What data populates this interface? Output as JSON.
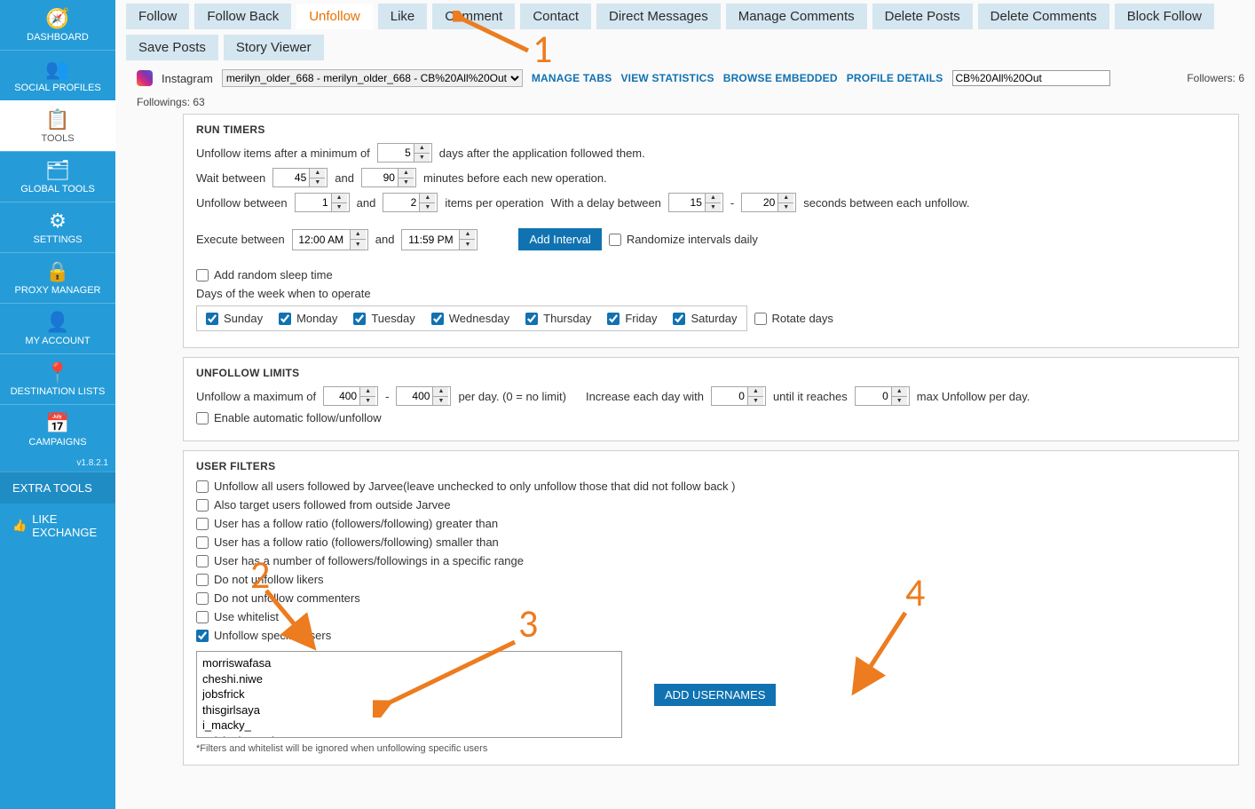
{
  "sidebar": {
    "items": [
      {
        "label": "DASHBOARD",
        "icon": "🧭"
      },
      {
        "label": "SOCIAL PROFILES",
        "icon": "👥"
      },
      {
        "label": "TOOLS",
        "icon": "📋",
        "active": true
      },
      {
        "label": "GLOBAL TOOLS",
        "icon": "🗂"
      },
      {
        "label": "SETTINGS",
        "icon": "⚙"
      },
      {
        "label": "PROXY MANAGER",
        "icon": "🔒"
      },
      {
        "label": "MY ACCOUNT",
        "icon": "👤"
      },
      {
        "label": "DESTINATION LISTS",
        "icon": "📍"
      },
      {
        "label": "CAMPAIGNS",
        "icon": "📅"
      }
    ],
    "version": "v1.8.2.1",
    "extra": "EXTRA TOOLS",
    "like": "LIKE EXCHANGE"
  },
  "tabs": [
    "Follow",
    "Follow Back",
    "Unfollow",
    "Like",
    "Comment",
    "Contact",
    "Direct Messages",
    "Manage Comments",
    "Delete Posts",
    "Delete Comments",
    "Block Follow",
    "Save Posts",
    "Story Viewer"
  ],
  "activeTab": "Unfollow",
  "accountbar": {
    "platform": "Instagram",
    "profileSelect": "merilyn_older_668 - merilyn_older_668 - CB%20All%20Out",
    "links": [
      "MANAGE TABS",
      "VIEW STATISTICS",
      "BROWSE EMBEDDED",
      "PROFILE DETAILS"
    ],
    "profileInput": "CB%20All%20Out",
    "followers": "Followers:  6",
    "followings": "Followings:  63"
  },
  "runTimers": {
    "title": "RUN TIMERS",
    "line1_a": "Unfollow items after a minimum of",
    "line1_val": "5",
    "line1_b": "days after the application followed them.",
    "waitA": "Wait between",
    "waitV1": "45",
    "waitAnd": "and",
    "waitV2": "90",
    "waitB": "minutes before each new operation.",
    "ubA": "Unfollow between",
    "ubV1": "1",
    "ubV2": "2",
    "ubB": "items per operation",
    "ubC": "With a delay between",
    "ubV3": "15",
    "dash": "-",
    "ubV4": "20",
    "ubD": "seconds between each unfollow.",
    "execA": "Execute between",
    "execT1": "12:00 AM",
    "execAnd": "and",
    "execT2": "11:59 PM",
    "addInterval": "Add Interval",
    "randomize": "Randomize intervals daily",
    "addSleep": "Add random sleep time",
    "daysLabel": "Days of the week when to operate",
    "days": [
      "Sunday",
      "Monday",
      "Tuesday",
      "Wednesday",
      "Thursday",
      "Friday",
      "Saturday"
    ],
    "rotate": "Rotate days"
  },
  "limits": {
    "title": "UNFOLLOW LIMITS",
    "a": "Unfollow a maximum of",
    "v1": "400",
    "dash": "-",
    "v2": "400",
    "b": "per day. (0 = no limit)",
    "c": "Increase each day with",
    "v3": "0",
    "d": "until it reaches",
    "v4": "0",
    "e": "max Unfollow per day.",
    "auto": "Enable automatic follow/unfollow"
  },
  "filters": {
    "title": "USER FILTERS",
    "items": [
      {
        "label": "Unfollow all users followed by Jarvee(leave unchecked to only unfollow those that did not follow back )",
        "checked": false
      },
      {
        "label": "Also target users followed from outside Jarvee",
        "checked": false
      },
      {
        "label": "User has a follow ratio (followers/following) greater than",
        "checked": false
      },
      {
        "label": "User has a follow ratio (followers/following) smaller than",
        "checked": false
      },
      {
        "label": "User has a number of followers/followings in a specific range",
        "checked": false
      },
      {
        "label": "Do not unfollow likers",
        "checked": false
      },
      {
        "label": "Do not unfollow commenters",
        "checked": false
      },
      {
        "label": "Use whitelist",
        "checked": false
      },
      {
        "label": "Unfollow specific users",
        "checked": true
      }
    ],
    "usernames": "morriswafasa\ncheshi.niwe\njobsfrick\nthisgirlsaya\ni_macky_\nazizi_njovu_chuma",
    "addBtn": "ADD USERNAMES",
    "note": "*Filters and whitelist will be ignored when unfollowing specific users"
  },
  "annotations": {
    "n1": "1",
    "n2": "2",
    "n3": "3",
    "n4": "4"
  }
}
